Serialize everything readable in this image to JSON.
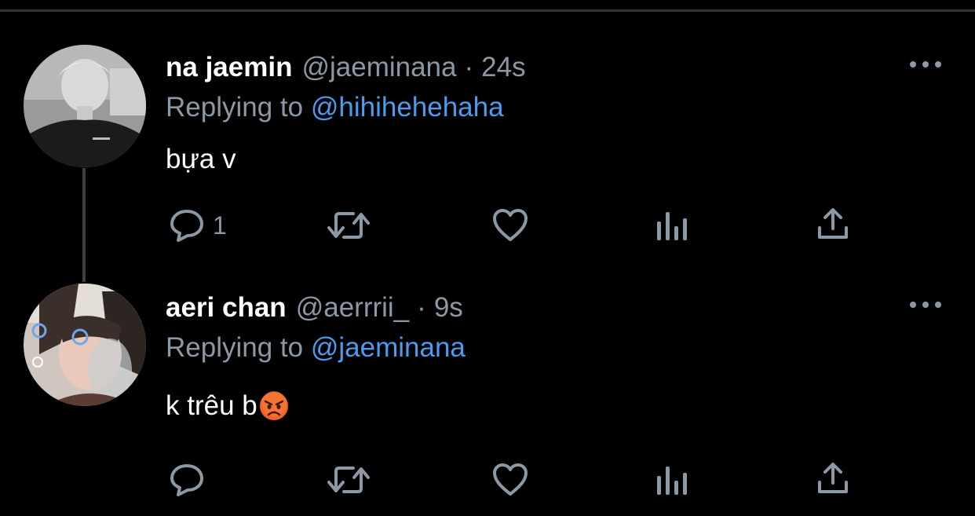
{
  "tweets": [
    {
      "name": "na jaemin",
      "handle": "@jaeminana",
      "separator": "·",
      "time": "24s",
      "replying_prefix": "Replying to",
      "replying_to": "@hihihehehaha",
      "text": "bựa v",
      "emoji": "",
      "reply_count": "1"
    },
    {
      "name": "aeri chan",
      "handle": "@aerrrii_",
      "separator": "·",
      "time": "9s",
      "replying_prefix": "Replying to",
      "replying_to": "@jaeminana",
      "text": "k trêu b",
      "emoji": "angry-face-emoji",
      "reply_count": ""
    }
  ],
  "actions": [
    "reply-icon",
    "retweet-icon",
    "like-icon",
    "analytics-icon",
    "share-icon"
  ],
  "colors": {
    "background": "#000000",
    "secondary_text": "#8b98a5",
    "link": "#4a9cf0",
    "divider": "#2f3336"
  }
}
